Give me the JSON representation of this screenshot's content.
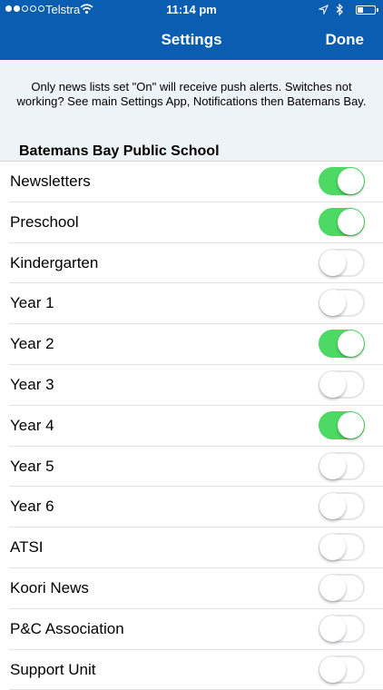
{
  "status_bar": {
    "carrier": "Telstra",
    "time": "11:14 pm",
    "signal_bars_filled": 2,
    "signal_bars_total": 5,
    "icons": [
      "wifi-icon",
      "location-arrow-icon",
      "bluetooth-icon",
      "battery-icon"
    ]
  },
  "nav": {
    "title": "Settings",
    "done_label": "Done",
    "bar_color": "#0b5db2"
  },
  "notice": "Only news lists set \"On\" will receive push alerts. Switches not working? See main Settings App, Notifications then Batemans Bay.",
  "section_title": "Batemans Bay Public School",
  "colors": {
    "switch_on": "#4cd964",
    "switch_off_border": "#e5e5ea"
  },
  "items": [
    {
      "label": "Newsletters",
      "on": true
    },
    {
      "label": "Preschool",
      "on": true
    },
    {
      "label": "Kindergarten",
      "on": false
    },
    {
      "label": "Year 1",
      "on": false
    },
    {
      "label": "Year 2",
      "on": true
    },
    {
      "label": "Year 3",
      "on": false
    },
    {
      "label": "Year 4",
      "on": true
    },
    {
      "label": "Year 5",
      "on": false
    },
    {
      "label": "Year 6",
      "on": false
    },
    {
      "label": "ATSI",
      "on": false
    },
    {
      "label": "Koori News",
      "on": false
    },
    {
      "label": "P&C Association",
      "on": false
    },
    {
      "label": "Support Unit",
      "on": false
    }
  ]
}
